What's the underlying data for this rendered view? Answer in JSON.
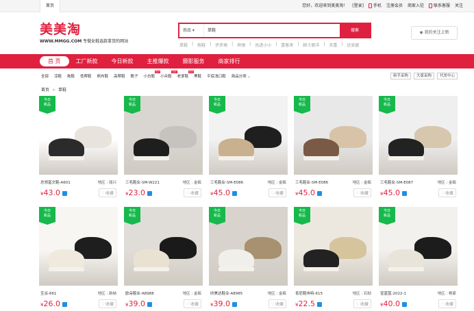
{
  "topbar": {
    "home": "首页",
    "greeting": "您好，欢迎来到美美淘！",
    "login": "[登录]",
    "mobile": "手机",
    "register": "注册会员",
    "merchant": "商家入驻",
    "service": "联系客服",
    "follow": "关注"
  },
  "logo": {
    "cn": "美美淘",
    "url": "WWW.MMGG.COM",
    "slogan": "专做女鞋选款拿货的网站"
  },
  "search": {
    "category": "商品",
    "query": "单鞋",
    "button": "搜索"
  },
  "hotwords": [
    "单鞋",
    "拖鞋",
    "步步高",
    "奔驰",
    "尚进小小",
    "喜客来",
    "顾士丽洋",
    "天喜",
    "达安妮"
  ],
  "follow_btn": "我的关注上新",
  "nav": [
    "首 页",
    "工厂新款",
    "今日新款",
    "主推爆款",
    "摄影服务",
    "商家排行"
  ],
  "cats": [
    "全部",
    "凉鞋",
    "拖鞋",
    "低帮鞋",
    "帆布鞋",
    "高帮鞋",
    "靴子",
    "小白鞋",
    "小众鞋",
    "老爹鞋",
    "黑鞋",
    "平底浅口鞋",
    "商品分类"
  ],
  "cat_hot": "HOT",
  "cat_right": [
    "新手采购",
    "大家采购",
    "代发中心"
  ],
  "crumb": {
    "home": "首页",
    "current": "单鞋"
  },
  "tag": {
    "line1": "今日",
    "line2": "新品"
  },
  "fav_label": "收藏",
  "products": [
    {
      "name": "总领富文鞋-A601",
      "loc": "地区 : 丽兴",
      "price": "43.0",
      "colors": [
        "#2b2b2b",
        "#e8e3dc",
        "#ffffff"
      ]
    },
    {
      "name": "三毛鞋业-SM-W221",
      "loc": "地区 : 金瓯",
      "price": "23.0",
      "colors": [
        "#1e1e1e",
        "#c6c2bd",
        "#d9d6d2"
      ]
    },
    {
      "name": "三毛鞋业-SM-E086",
      "loc": "地区 : 金瓯",
      "price": "45.0",
      "colors": [
        "#c9b08e",
        "#1f1f1f",
        "#f2f2f2"
      ]
    },
    {
      "name": "三毛鞋业-SM-E086",
      "loc": "地区 : 金瓯",
      "price": "45.0",
      "colors": [
        "#7a5a44",
        "#d9c3a8",
        "#e8e8e8"
      ]
    },
    {
      "name": "三毛鞋业-SM-E087",
      "loc": "地区 : 金瓯",
      "price": "45.0",
      "colors": [
        "#222222",
        "#d6c7ae",
        "#efefef"
      ]
    },
    {
      "name": "互派-661",
      "loc": "地区 : 新纳",
      "price": "26.0",
      "colors": [
        "#efe9de",
        "#1e1e1e",
        "#f8f6f2"
      ]
    },
    {
      "name": "欧朵鞋业-A8988",
      "loc": "地区 : 金瓯",
      "price": "39.0",
      "colors": [
        "#e9e2d3",
        "#1a1a1a",
        "#e0ddd8"
      ]
    },
    {
      "name": "欣美达鞋业-A8985",
      "loc": "地区 : 金瓯",
      "price": "39.0",
      "colors": [
        "#f1efe9",
        "#a79170",
        "#d8d4cd"
      ]
    },
    {
      "name": "肯尼鞋伟特-615",
      "loc": "地区 : 石帖",
      "price": "22.5",
      "colors": [
        "#222222",
        "#d6c49d",
        "#ece8e0"
      ]
    },
    {
      "name": "宝蓝蓝-2022-1",
      "loc": "地区 : 杨家",
      "price": "40.0",
      "colors": [
        "#e9e4da",
        "#1c1c1c",
        "#f3f1ed"
      ]
    }
  ]
}
